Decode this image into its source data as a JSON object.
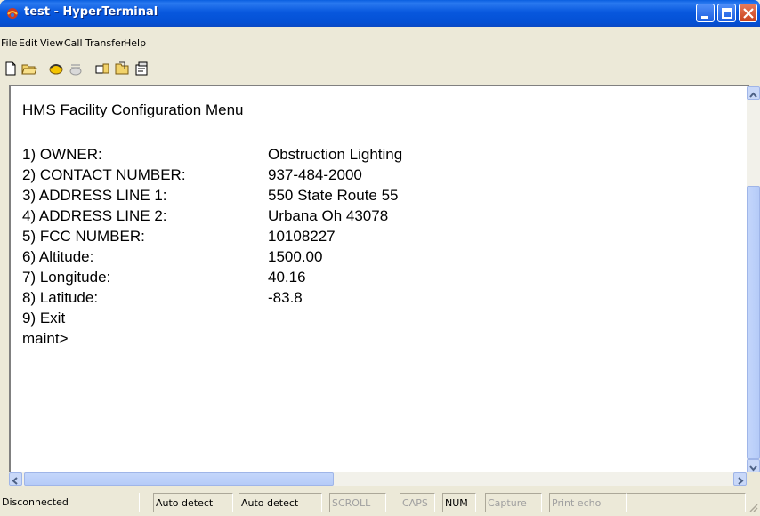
{
  "window": {
    "title": "test - HyperTerminal"
  },
  "menu": [
    "File",
    "Edit",
    "View",
    "Call",
    "Transfer",
    "Help"
  ],
  "terminal": {
    "heading": "HMS Facility Configuration Menu",
    "items": [
      {
        "label": "1)  OWNER:",
        "value": "Obstruction Lighting"
      },
      {
        "label": "2)  CONTACT NUMBER:",
        "value": "937-484-2000"
      },
      {
        "label": "3)  ADDRESS LINE 1:",
        "value": "550 State Route 55"
      },
      {
        "label": "4)  ADDRESS LINE 2:",
        "value": "Urbana Oh 43078"
      },
      {
        "label": "5)  FCC NUMBER:",
        "value": "10108227"
      },
      {
        "label": "6)  Altitude:",
        "value": "1500.00"
      },
      {
        "label": "7)  Longitude:",
        "value": "40.16"
      },
      {
        "label": "8)  Latitude:",
        "value": "-83.8"
      },
      {
        "label": "9)  Exit",
        "value": ""
      }
    ],
    "prompt": "maint>"
  },
  "status": {
    "connection": "Disconnected",
    "detect1": "Auto detect",
    "detect2": "Auto detect",
    "scroll": "SCROLL",
    "caps": "CAPS",
    "num": "NUM",
    "capture": "Capture",
    "print_echo": "Print echo"
  }
}
